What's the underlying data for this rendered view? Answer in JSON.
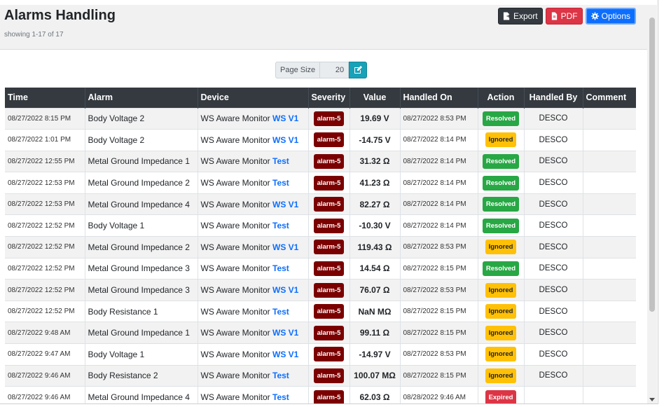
{
  "header": {
    "title": "Alarms Handling",
    "subtitle": "showing 1-17 of 17",
    "export_label": "Export",
    "pdf_label": "PDF",
    "options_label": "Options"
  },
  "pager": {
    "label": "Page Size",
    "value": "20"
  },
  "columns": {
    "time": "Time",
    "alarm": "Alarm",
    "device": "Device",
    "severity": "Severity",
    "value": "Value",
    "handled_on": "Handled On",
    "action": "Action",
    "handled_by": "Handled By",
    "comment": "Comment"
  },
  "rows": [
    {
      "time": "08/27/2022 8:15 PM",
      "alarm": "Body Voltage 2",
      "device": "WS Aware Monitor",
      "device_tag": "WS V1",
      "severity": "alarm-5",
      "value": "19.69 V",
      "handled_on": "08/27/2022 8:53 PM",
      "action": "Resolved",
      "handled_by": "DESCO",
      "comment": ""
    },
    {
      "time": "08/27/2022 1:01 PM",
      "alarm": "Body Voltage 2",
      "device": "WS Aware Monitor",
      "device_tag": "WS V1",
      "severity": "alarm-5",
      "value": "-14.75 V",
      "handled_on": "08/27/2022 8:14 PM",
      "action": "Ignored",
      "handled_by": "DESCO",
      "comment": ""
    },
    {
      "time": "08/27/2022 12:55 PM",
      "alarm": "Metal Ground Impedance 1",
      "device": "WS Aware Monitor",
      "device_tag": "Test",
      "severity": "alarm-5",
      "value": "31.32 Ω",
      "handled_on": "08/27/2022 8:14 PM",
      "action": "Resolved",
      "handled_by": "DESCO",
      "comment": ""
    },
    {
      "time": "08/27/2022 12:53 PM",
      "alarm": "Metal Ground Impedance 2",
      "device": "WS Aware Monitor",
      "device_tag": "Test",
      "severity": "alarm-5",
      "value": "41.23 Ω",
      "handled_on": "08/27/2022 8:14 PM",
      "action": "Resolved",
      "handled_by": "DESCO",
      "comment": ""
    },
    {
      "time": "08/27/2022 12:53 PM",
      "alarm": "Metal Ground Impedance 4",
      "device": "WS Aware Monitor",
      "device_tag": "WS V1",
      "severity": "alarm-5",
      "value": "82.27 Ω",
      "handled_on": "08/27/2022 8:14 PM",
      "action": "Resolved",
      "handled_by": "DESCO",
      "comment": ""
    },
    {
      "time": "08/27/2022 12:52 PM",
      "alarm": "Body Voltage 1",
      "device": "WS Aware Monitor",
      "device_tag": "Test",
      "severity": "alarm-5",
      "value": "-10.30 V",
      "handled_on": "08/27/2022 8:14 PM",
      "action": "Resolved",
      "handled_by": "DESCO",
      "comment": ""
    },
    {
      "time": "08/27/2022 12:52 PM",
      "alarm": "Metal Ground Impedance 2",
      "device": "WS Aware Monitor",
      "device_tag": "WS V1",
      "severity": "alarm-5",
      "value": "119.43 Ω",
      "handled_on": "08/27/2022 8:53 PM",
      "action": "Ignored",
      "handled_by": "DESCO",
      "comment": ""
    },
    {
      "time": "08/27/2022 12:52 PM",
      "alarm": "Metal Ground Impedance 3",
      "device": "WS Aware Monitor",
      "device_tag": "Test",
      "severity": "alarm-5",
      "value": "14.54 Ω",
      "handled_on": "08/27/2022 8:15 PM",
      "action": "Resolved",
      "handled_by": "DESCO",
      "comment": ""
    },
    {
      "time": "08/27/2022 12:52 PM",
      "alarm": "Metal Ground Impedance 3",
      "device": "WS Aware Monitor",
      "device_tag": "WS V1",
      "severity": "alarm-5",
      "value": "76.07 Ω",
      "handled_on": "08/27/2022 8:53 PM",
      "action": "Ignored",
      "handled_by": "DESCO",
      "comment": ""
    },
    {
      "time": "08/27/2022 12:52 PM",
      "alarm": "Body Resistance 1",
      "device": "WS Aware Monitor",
      "device_tag": "Test",
      "severity": "alarm-5",
      "value": "NaN MΩ",
      "handled_on": "08/27/2022 8:15 PM",
      "action": "Ignored",
      "handled_by": "DESCO",
      "comment": ""
    },
    {
      "time": "08/27/2022 9:48 AM",
      "alarm": "Metal Ground Impedance 1",
      "device": "WS Aware Monitor",
      "device_tag": "WS V1",
      "severity": "alarm-5",
      "value": "99.11 Ω",
      "handled_on": "08/27/2022 8:15 PM",
      "action": "Ignored",
      "handled_by": "DESCO",
      "comment": ""
    },
    {
      "time": "08/27/2022 9:47 AM",
      "alarm": "Body Voltage 1",
      "device": "WS Aware Monitor",
      "device_tag": "WS V1",
      "severity": "alarm-5",
      "value": "-14.97 V",
      "handled_on": "08/27/2022 8:53 PM",
      "action": "Ignored",
      "handled_by": "DESCO",
      "comment": ""
    },
    {
      "time": "08/27/2022 9:46 AM",
      "alarm": "Body Resistance 2",
      "device": "WS Aware Monitor",
      "device_tag": "Test",
      "severity": "alarm-5",
      "value": "100.07 MΩ",
      "handled_on": "08/27/2022 8:15 PM",
      "action": "Ignored",
      "handled_by": "DESCO",
      "comment": ""
    },
    {
      "time": "08/27/2022 9:46 AM",
      "alarm": "Metal Ground Impedance 4",
      "device": "WS Aware Monitor",
      "device_tag": "Test",
      "severity": "alarm-5",
      "value": "62.03 Ω",
      "handled_on": "08/28/2022 9:46 AM",
      "action": "Expired",
      "handled_by": "",
      "comment": ""
    }
  ],
  "icons": {
    "export": "export-icon",
    "pdf": "file-pdf-icon",
    "options": "gear-icon",
    "edit": "edit-icon"
  },
  "colors": {
    "severity_bg": "#7b0000",
    "resolved": "#28a745",
    "ignored": "#ffc107",
    "expired": "#dc3545",
    "link": "#0d6efd",
    "header_bg": "#343a40"
  }
}
